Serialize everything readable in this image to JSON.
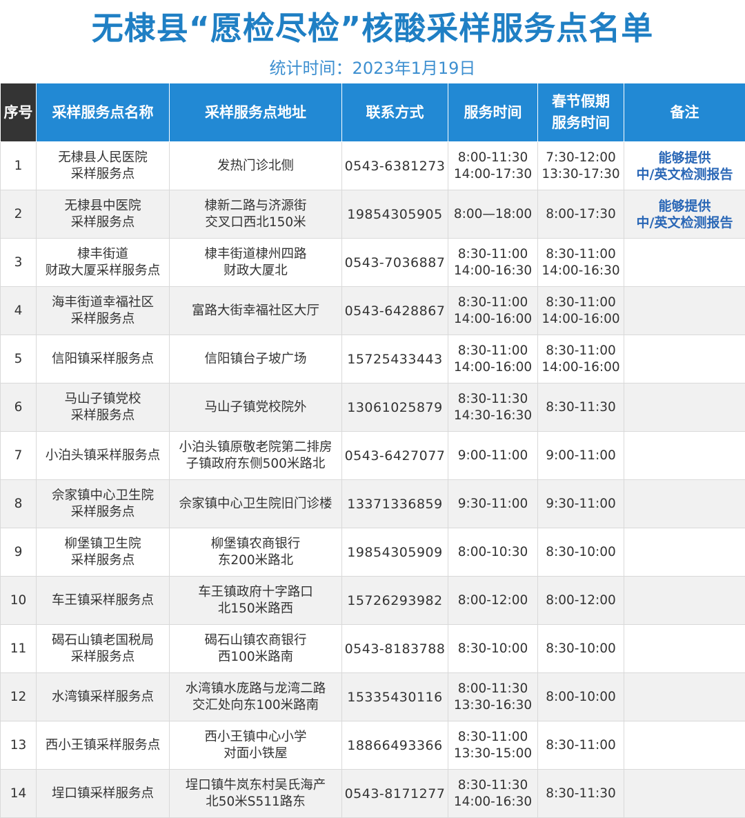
{
  "title": "无棣县“愿检尽检”核酸采样服务点名单",
  "subtitle": "统计时间：2023年1月19日",
  "columns": [
    "序号",
    "采样服务点名称",
    "采样服务点地址",
    "联系方式",
    "服务时间",
    [
      "春节假期",
      "服务时间"
    ],
    "备注"
  ],
  "rows": [
    {
      "seq": "1",
      "name": [
        "无棣县人民医院",
        "采样服务点"
      ],
      "addr": [
        "发热门诊北侧"
      ],
      "phone": "0543-6381273",
      "time": [
        "8:00-11:30",
        "14:00-17:30"
      ],
      "holiday": [
        "7:30-12:00",
        "13:30-17:30"
      ],
      "remark": [
        "能够提供",
        "中/英文检测报告"
      ]
    },
    {
      "seq": "2",
      "name": [
        "无棣县中医院",
        "采样服务点"
      ],
      "addr": [
        "棣新二路与济源街",
        "交叉口西北150米"
      ],
      "phone": "19854305905",
      "time": [
        "8:00—18:00"
      ],
      "holiday": [
        "8:00-17:30"
      ],
      "remark": [
        "能够提供",
        "中/英文检测报告"
      ]
    },
    {
      "seq": "3",
      "name": [
        "棣丰街道",
        "财政大厦采样服务点"
      ],
      "addr": [
        "棣丰街道棣州四路",
        "财政大厦北"
      ],
      "phone": "0543-7036887",
      "time": [
        "8:30-11:00",
        "14:00-16:30"
      ],
      "holiday": [
        "8:30-11:00",
        "14:00-16:30"
      ],
      "remark": []
    },
    {
      "seq": "4",
      "name": [
        "海丰街道幸福社区",
        "采样服务点"
      ],
      "addr": [
        "富路大街幸福社区大厅"
      ],
      "phone": "0543-6428867",
      "time": [
        "8:30-11:00",
        "14:00-16:00"
      ],
      "holiday": [
        "8:30-11:00",
        "14:00-16:00"
      ],
      "remark": []
    },
    {
      "seq": "5",
      "name": [
        "信阳镇采样服务点"
      ],
      "addr": [
        "信阳镇台子坡广场"
      ],
      "phone": "15725433443",
      "time": [
        "8:30-11:00",
        "14:00-16:00"
      ],
      "holiday": [
        "8:30-11:00",
        "14:00-16:00"
      ],
      "remark": []
    },
    {
      "seq": "6",
      "name": [
        "马山子镇党校",
        "采样服务点"
      ],
      "addr": [
        "马山子镇党校院外"
      ],
      "phone": "13061025879",
      "time": [
        "8:30-11:30",
        "14:30-16:30"
      ],
      "holiday": [
        "8:30-11:30"
      ],
      "remark": []
    },
    {
      "seq": "7",
      "name": [
        "小泊头镇采样服务点"
      ],
      "addr": [
        "小泊头镇原敬老院第二排房",
        "子镇政府东侧500米路北"
      ],
      "phone": "0543-6427077",
      "time": [
        "9:00-11:00"
      ],
      "holiday": [
        "9:00-11:00"
      ],
      "remark": []
    },
    {
      "seq": "8",
      "name": [
        "佘家镇中心卫生院",
        "采样服务点"
      ],
      "addr": [
        "佘家镇中心卫生院旧门诊楼"
      ],
      "phone": "13371336859",
      "time": [
        "9:30-11:00"
      ],
      "holiday": [
        "9:30-11:00"
      ],
      "remark": []
    },
    {
      "seq": "9",
      "name": [
        "柳堡镇卫生院",
        "采样服务点"
      ],
      "addr": [
        "柳堡镇农商银行",
        "东200米路北"
      ],
      "phone": "19854305909",
      "time": [
        "8:00-10:30"
      ],
      "holiday": [
        "8:30-10:00"
      ],
      "remark": []
    },
    {
      "seq": "10",
      "name": [
        "车王镇采样服务点"
      ],
      "addr": [
        "车王镇政府十字路口",
        "北150米路西"
      ],
      "phone": "15726293982",
      "time": [
        "8:00-12:00"
      ],
      "holiday": [
        "8:00-12:00"
      ],
      "remark": []
    },
    {
      "seq": "11",
      "name": [
        "碣石山镇老国税局",
        "采样服务点"
      ],
      "addr": [
        "碣石山镇农商银行",
        "西100米路南"
      ],
      "phone": "0543-8183788",
      "time": [
        "8:30-10:00"
      ],
      "holiday": [
        "8:30-10:00"
      ],
      "remark": []
    },
    {
      "seq": "12",
      "name": [
        "水湾镇采样服务点"
      ],
      "addr": [
        "水湾镇水庞路与龙湾二路",
        "交汇处向东100米路南"
      ],
      "phone": "15335430116",
      "time": [
        "8:00-11:30",
        "13:30-16:30"
      ],
      "holiday": [
        "8:00-10:00"
      ],
      "remark": []
    },
    {
      "seq": "13",
      "name": [
        "西小王镇采样服务点"
      ],
      "addr": [
        "西小王镇中心小学",
        "对面小铁屋"
      ],
      "phone": "18866493366",
      "time": [
        "8:30-11:00",
        "13:30-15:00"
      ],
      "holiday": [
        "8:30-11:00"
      ],
      "remark": []
    },
    {
      "seq": "14",
      "name": [
        "埕口镇采样服务点"
      ],
      "addr": [
        "埕口镇牛岚东村吴氏海产",
        "北50米S511路东"
      ],
      "phone": "0543-8171277",
      "time": [
        "8:30-11:30",
        "14:00-16:30"
      ],
      "holiday": [
        "8:30-11:30"
      ],
      "remark": []
    }
  ]
}
